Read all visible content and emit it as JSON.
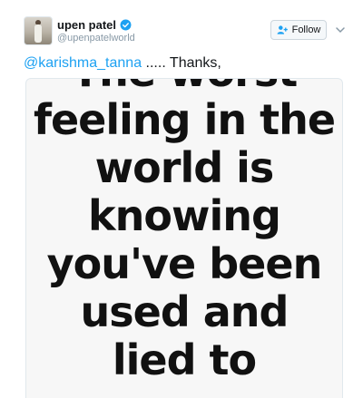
{
  "user": {
    "display_name": "upen patel",
    "handle": "@upenpatelworld"
  },
  "follow": {
    "label": "Follow"
  },
  "tweet": {
    "mention": "@karishma_tanna",
    "text": " ..... Thanks,"
  },
  "media": {
    "lines": [
      "The worst",
      "feeling in the",
      "world is",
      "knowing",
      "you've been",
      "used and",
      "lied to"
    ]
  },
  "icons": {
    "verified": "verified-badge-icon",
    "follow": "add-user-icon",
    "menu": "chevron-down-icon"
  },
  "colors": {
    "brand": "#1da1f2",
    "text": "#14171a",
    "muted": "#8899a6"
  }
}
